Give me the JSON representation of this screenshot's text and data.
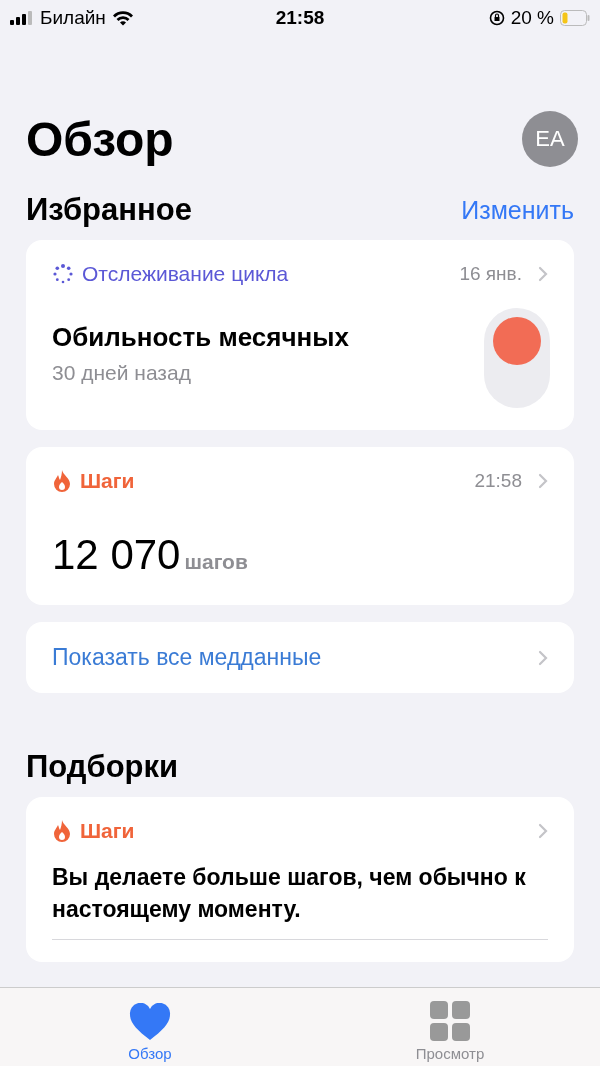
{
  "status_bar": {
    "carrier": "Билайн",
    "time": "21:58",
    "battery": "20 %"
  },
  "header": {
    "title": "Обзор",
    "avatar": "EA"
  },
  "favorites": {
    "title": "Избранное",
    "action": "Изменить",
    "cards": [
      {
        "kind": "cycle",
        "category": "Отслеживание цикла",
        "date": "16 янв.",
        "headline": "Обильность месячных",
        "subtitle": "30 дней назад"
      },
      {
        "kind": "steps",
        "category": "Шаги",
        "date": "21:58",
        "value": "12 070",
        "unit": "шагов"
      },
      {
        "kind": "link",
        "label": "Показать все медданные"
      }
    ]
  },
  "collections": {
    "title": "Подборки",
    "cards": [
      {
        "category": "Шаги",
        "text": "Вы делаете больше шагов, чем обычно к настоящему моменту."
      }
    ]
  },
  "tab_bar": [
    {
      "label": "Обзор",
      "selected": true
    },
    {
      "label": "Просмотр",
      "selected": false
    }
  ]
}
